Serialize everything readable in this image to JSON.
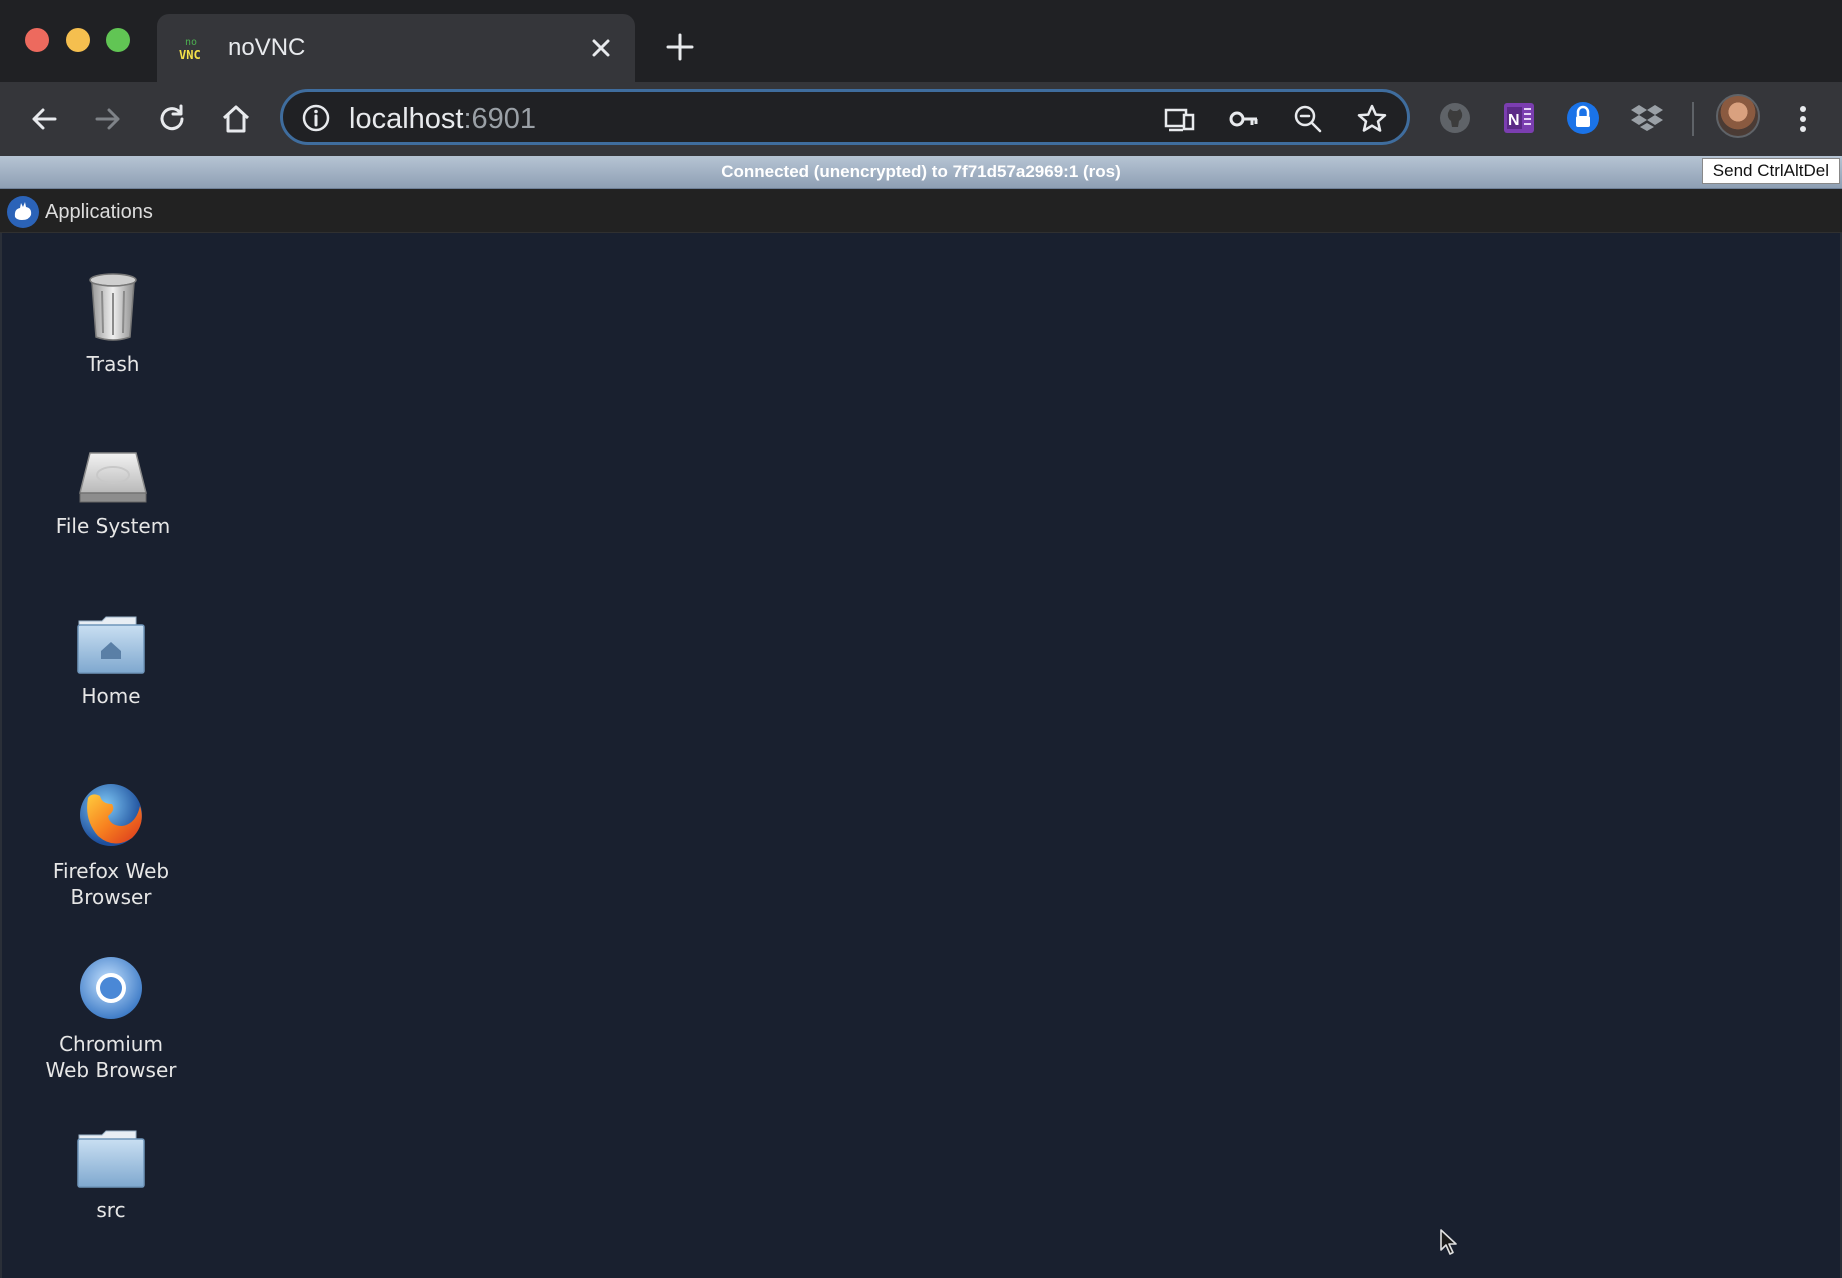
{
  "browser": {
    "tab": {
      "title": "noVNC",
      "favicon": "novnc-favicon-icon",
      "favicon_text_top": "no",
      "favicon_text_bottom": "VNC"
    },
    "address": {
      "host": "localhost",
      "port": ":6901"
    },
    "nav_icons": [
      "back-icon",
      "forward-icon",
      "reload-icon",
      "home-icon"
    ],
    "omnibox_icons": [
      "info-icon",
      "cast-icon",
      "key-icon",
      "zoom-out-icon",
      "star-icon"
    ],
    "extensions": [
      "github-icon",
      "onenote-icon",
      "lastpass-lock-icon",
      "dropbox-icon"
    ],
    "colors": {
      "titlebar": "#202124",
      "toolbar": "#35363a",
      "omnibox_border": "#3f6d9e"
    }
  },
  "vnc": {
    "status": "Connected (unencrypted) to 7f71d57a2969:1 (ros)",
    "ctrl_alt_del": "Send CtrlAltDel"
  },
  "panel": {
    "applications_label": "Applications"
  },
  "desktop": {
    "background": "#19202f",
    "icons": [
      {
        "label": "Trash",
        "icon": "trash-icon"
      },
      {
        "label": "File System",
        "icon": "hard-drive-icon"
      },
      {
        "label": "Home",
        "icon": "home-folder-icon"
      },
      {
        "label_line1": "Firefox Web",
        "label_line2": "Browser",
        "icon": "firefox-icon"
      },
      {
        "label_line1": "Chromium",
        "label_line2": "Web Browser",
        "icon": "chromium-icon"
      },
      {
        "label": "src",
        "icon": "folder-icon"
      }
    ]
  }
}
